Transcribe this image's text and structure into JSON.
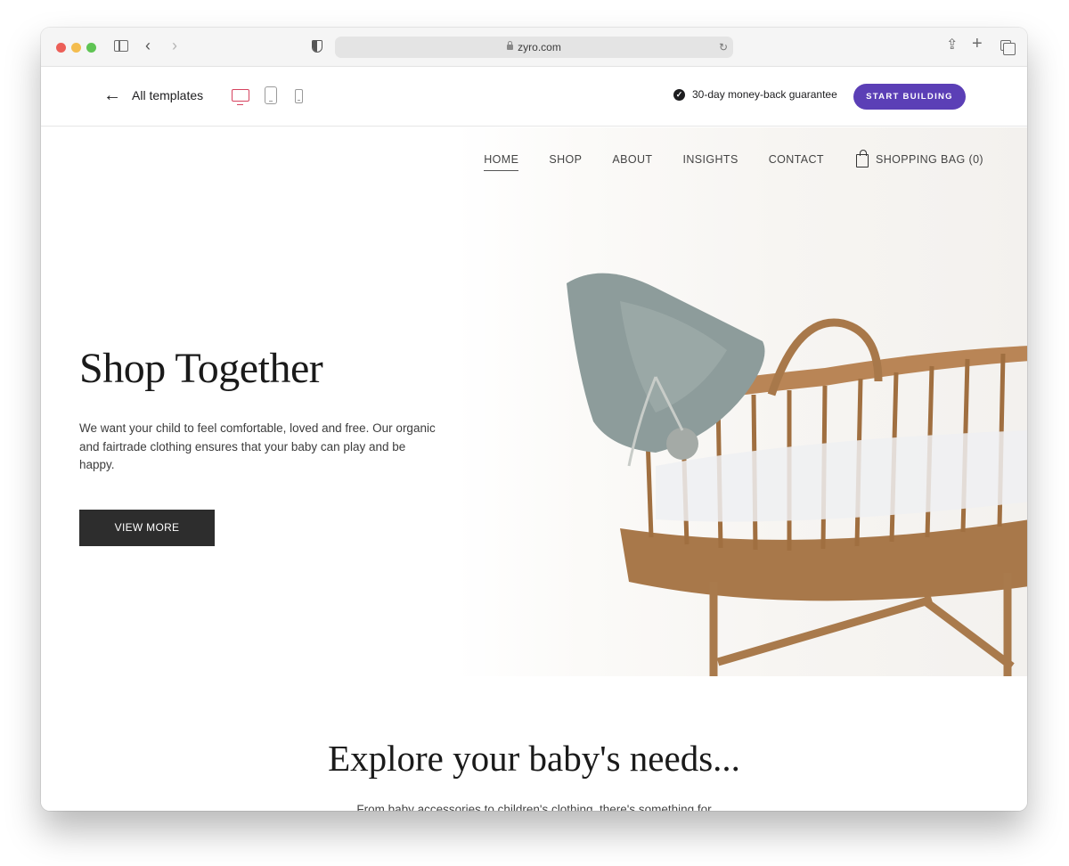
{
  "browser": {
    "url": "zyro.com",
    "icons": {
      "sidebar": "sidebar-toggle-icon",
      "back": "chevron-left-icon",
      "forward": "chevron-right-icon",
      "privacy": "shield-icon",
      "lock": "lock-icon",
      "reload": "reload-icon",
      "share": "share-icon",
      "new_tab": "plus-icon",
      "tabs": "tab-overview-icon"
    },
    "glyphs": {
      "back": "‹",
      "forward": "›",
      "reload": "↻",
      "share": "⇪",
      "plus": "+"
    }
  },
  "preview_bar": {
    "back_label": "All templates",
    "back_arrow": "←",
    "devices": [
      {
        "name": "desktop",
        "active": true
      },
      {
        "name": "tablet",
        "active": false
      },
      {
        "name": "mobile",
        "active": false
      }
    ],
    "guarantee_text": "30-day money-back guarantee",
    "check_glyph": "✓",
    "start_button": "START BUILDING",
    "accent_color": "#5b3fb6",
    "active_device_color": "#d6435f"
  },
  "site": {
    "nav": {
      "items": [
        {
          "label": "HOME",
          "active": true
        },
        {
          "label": "SHOP",
          "active": false
        },
        {
          "label": "ABOUT",
          "active": false
        },
        {
          "label": "INSIGHTS",
          "active": false
        },
        {
          "label": "CONTACT",
          "active": false
        }
      ],
      "bag_label": "SHOPPING BAG (0)"
    },
    "hero": {
      "title": "Shop Together",
      "text": "We want your child to feel comfortable, loved and free. Our organic and fairtrade clothing ensures that your baby can play and be happy.",
      "button": "VIEW MORE",
      "image_alt": "Wicker bassinet with knitted baby bonnet"
    },
    "explore": {
      "title": "Explore your baby's needs...",
      "subtitle": "From baby accessories to children's clothing, there's something for"
    }
  }
}
